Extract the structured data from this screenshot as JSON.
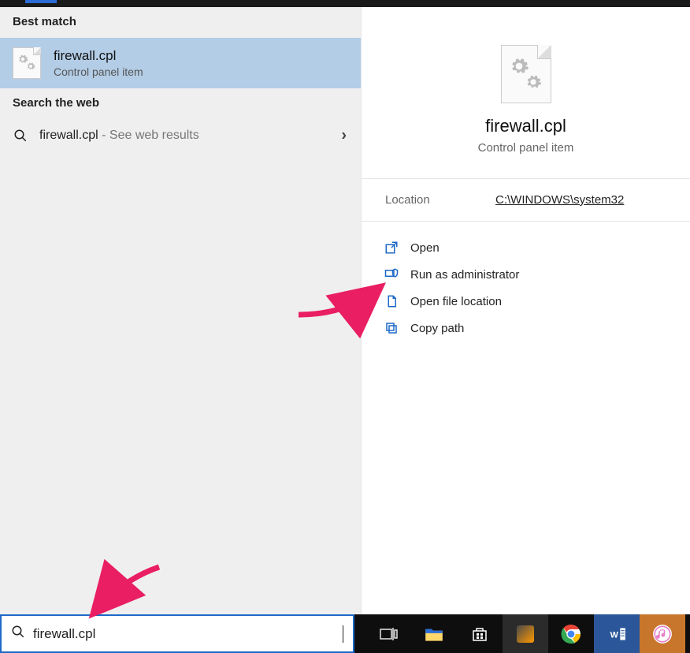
{
  "left": {
    "best_match_label": "Best match",
    "selected": {
      "title": "firewall.cpl",
      "subtitle": "Control panel item"
    },
    "search_web_label": "Search the web",
    "web": {
      "query": "firewall.cpl",
      "hint": " - See web results"
    }
  },
  "right": {
    "title": "firewall.cpl",
    "subtitle": "Control panel item",
    "location_label": "Location",
    "location_value": "C:\\WINDOWS\\system32",
    "actions": {
      "open": "Open",
      "run_admin": "Run as administrator",
      "open_loc": "Open file location",
      "copy_path": "Copy path"
    }
  },
  "search_input": "firewall.cpl"
}
